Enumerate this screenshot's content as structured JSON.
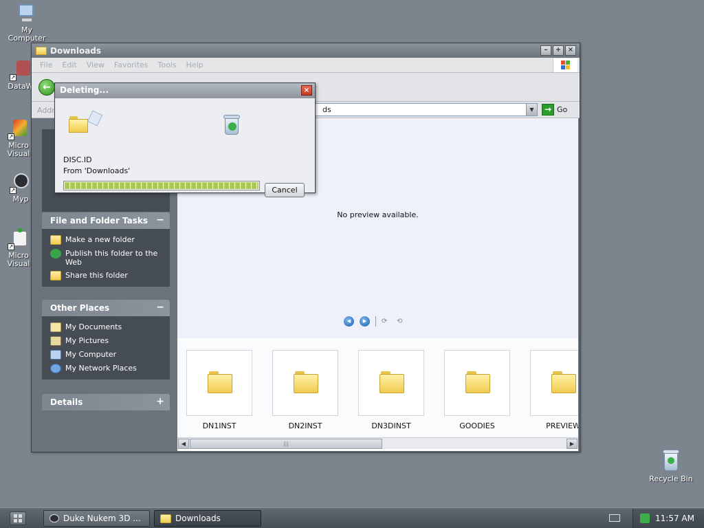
{
  "desktop": {
    "icons": [
      {
        "label": "My Computer"
      },
      {
        "label": "DataW"
      },
      {
        "label": "Micro Visual"
      },
      {
        "label": "Myp"
      },
      {
        "label": "Micro Visual"
      }
    ],
    "recycle_bin": "Recycle Bin"
  },
  "window": {
    "title": "Downloads",
    "controls": [
      "–",
      "+",
      "×"
    ],
    "menu": [
      "File",
      "Edit",
      "View",
      "Favorites",
      "Tools",
      "Help"
    ],
    "address_label": "Addr",
    "address_value": "ds",
    "go_label": "Go"
  },
  "tasks": {
    "file_folder": {
      "title": "File and Folder Tasks",
      "toggle": "−",
      "items": [
        "Make a new folder",
        "Publish this folder to the Web",
        "Share this folder"
      ]
    },
    "other_places": {
      "title": "Other Places",
      "toggle": "−",
      "items": [
        "My Documents",
        "My Pictures",
        "My Computer",
        "My Network Places"
      ]
    },
    "details": {
      "title": "Details",
      "toggle": "+"
    }
  },
  "preview": {
    "message": "No preview available."
  },
  "filmstrip": [
    "DN1INST",
    "DN2INST",
    "DN3DINST",
    "GOODIES",
    "PREVIEW"
  ],
  "dialog": {
    "title": "Deleting...",
    "close": "×",
    "file": "DISC.ID",
    "from": "From 'Downloads'",
    "progress": 1.0,
    "cancel": "Cancel"
  },
  "taskbar": {
    "buttons": [
      "Duke Nukem 3D ...",
      "Downloads"
    ],
    "clock": "11:57 AM"
  },
  "colors": {
    "desktop": "#7c848e",
    "task_panel_body": "#454c54",
    "progress_fill": "#a9c85a"
  }
}
